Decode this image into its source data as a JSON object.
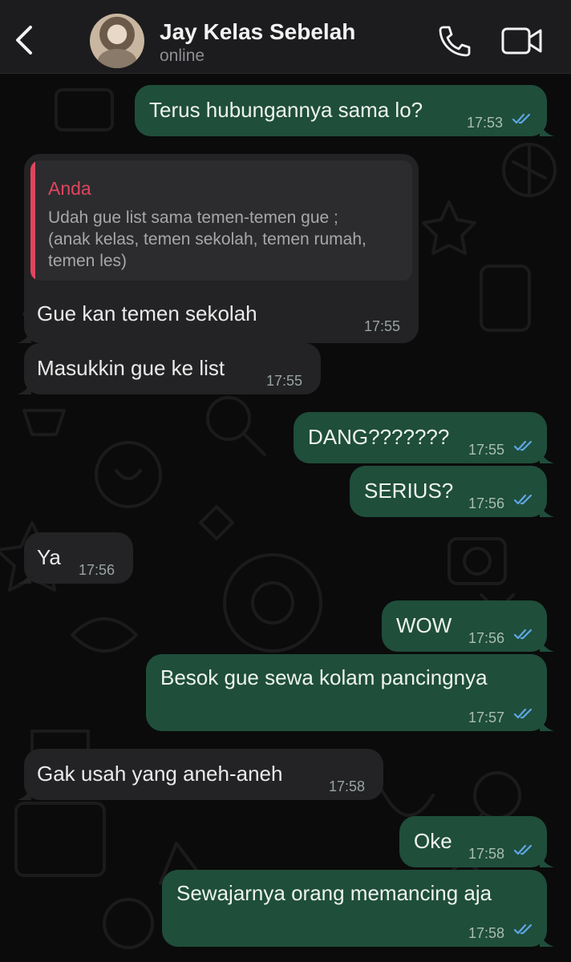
{
  "header": {
    "back_icon": "chevron-left-icon",
    "contact_name": "Jay Kelas Sebelah",
    "status": "online",
    "call_icon": "phone-icon",
    "video_icon": "video-camera-icon"
  },
  "colors": {
    "header_bg": "#1c1c1e",
    "chat_bg": "#0b0b0b",
    "incoming_bubble": "#232325",
    "outgoing_bubble": "#1f4e3b",
    "quote_accent": "#e0455f",
    "read_ticks": "#5ea7e6"
  },
  "messages": [
    {
      "dir": "out",
      "text": "Terus hubungannya sama lo?",
      "time": "17:53",
      "read": true
    },
    {
      "dir": "in",
      "reply_to": {
        "name": "Anda",
        "text": "Udah gue list sama temen-temen gue ;\n(anak kelas, temen sekolah, temen rumah,\ntemen les)"
      },
      "text": "Gue kan temen sekolah",
      "time": "17:55"
    },
    {
      "dir": "in",
      "text": "Masukkin gue ke list",
      "time": "17:55"
    },
    {
      "dir": "out",
      "text": "DANG???????",
      "time": "17:55",
      "read": true
    },
    {
      "dir": "out",
      "text": "SERIUS?",
      "time": "17:56",
      "read": true
    },
    {
      "dir": "in",
      "text": "Ya",
      "time": "17:56"
    },
    {
      "dir": "out",
      "text": "WOW",
      "time": "17:56",
      "read": true
    },
    {
      "dir": "out",
      "text": "Besok gue sewa kolam pancingnya",
      "time": "17:57",
      "read": true
    },
    {
      "dir": "in",
      "text": "Gak usah yang aneh-aneh",
      "time": "17:58"
    },
    {
      "dir": "out",
      "text": "Oke",
      "time": "17:58",
      "read": true
    },
    {
      "dir": "out",
      "text": "Sewajarnya orang memancing aja",
      "time": "17:58",
      "read": true
    }
  ]
}
